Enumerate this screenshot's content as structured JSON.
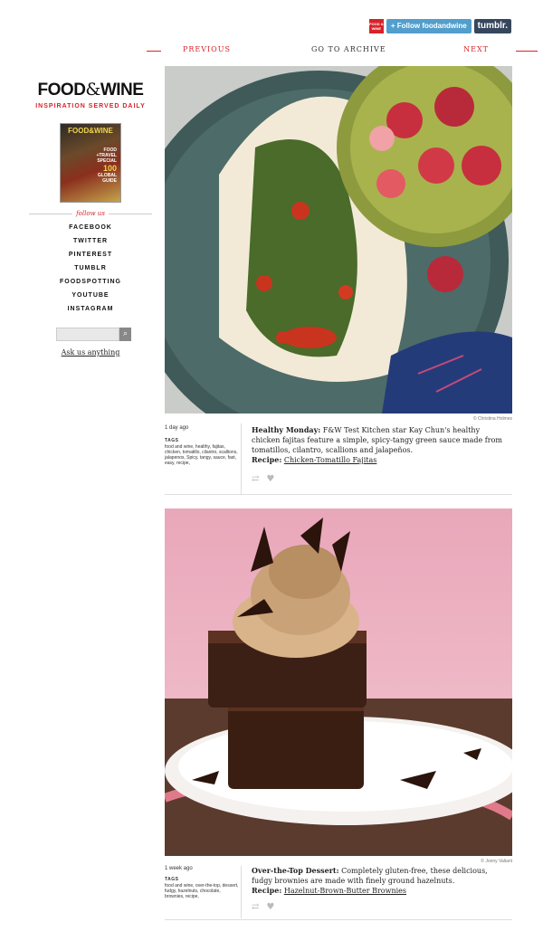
{
  "topbar": {
    "badge": "FOOD & WINE",
    "follow_label": "+ Follow foodandwine",
    "tumblr_label": "tumblr."
  },
  "nav": {
    "previous": "PREVIOUS",
    "archive": "GO TO ARCHIVE",
    "next": "NEXT"
  },
  "sidebar": {
    "logo_left": "FOOD",
    "logo_amp": "&",
    "logo_right": "WINE",
    "tagline": "INSPIRATION SERVED DAILY",
    "magazine": {
      "title": "FOOD&WINE",
      "lines": [
        "FOOD",
        "+TRAVEL",
        "SPECIAL",
        "100",
        "GLOBAL",
        "GUIDE"
      ]
    },
    "follow_us": "follow us",
    "social": [
      "FACEBOOK",
      "TWITTER",
      "PINTEREST",
      "TUMBLR",
      "FOODSPOTTING",
      "YOUTUBE",
      "INSTAGRAM"
    ],
    "search_button": "⌕",
    "ask": "Ask us anything"
  },
  "posts": [
    {
      "credit": "© Christina Holmes",
      "time": "1 day ago",
      "tags_label": "TAGS",
      "tags": "food and wine, healthy, fajitas, chicken, tomatillo, cilantro, scallions, jalapenos, Spicy, tangy, sauce, fast, easy, recipe,",
      "headline": "Healthy Monday:",
      "text": " F&W Test Kitchen star Kay Chun's healthy chicken fajitas feature a simple, spicy-tangy green sauce made from tomatillos, cilantro, scallions and jalapeños.",
      "recipe_label": "Recipe:",
      "recipe_link": "Chicken-Tomatillo Fajitas",
      "reblog_icon": "⇄",
      "like_icon": "♥"
    },
    {
      "credit": "© Jonny Valiant",
      "time": "1 week ago",
      "tags_label": "TAGS",
      "tags": "food and wine, over-the-top, dessert, fudgy, hazelnuts, chocolate, brownies, recipe,",
      "headline": "Over-the-Top Dessert:",
      "text": " Completely gluten-free, these delicious, fudgy brownies are made with finely ground hazelnuts.",
      "recipe_label": "Recipe:",
      "recipe_link": "Hazelnut-Brown-Butter Brownies",
      "reblog_icon": "⇄",
      "like_icon": "♥"
    }
  ]
}
